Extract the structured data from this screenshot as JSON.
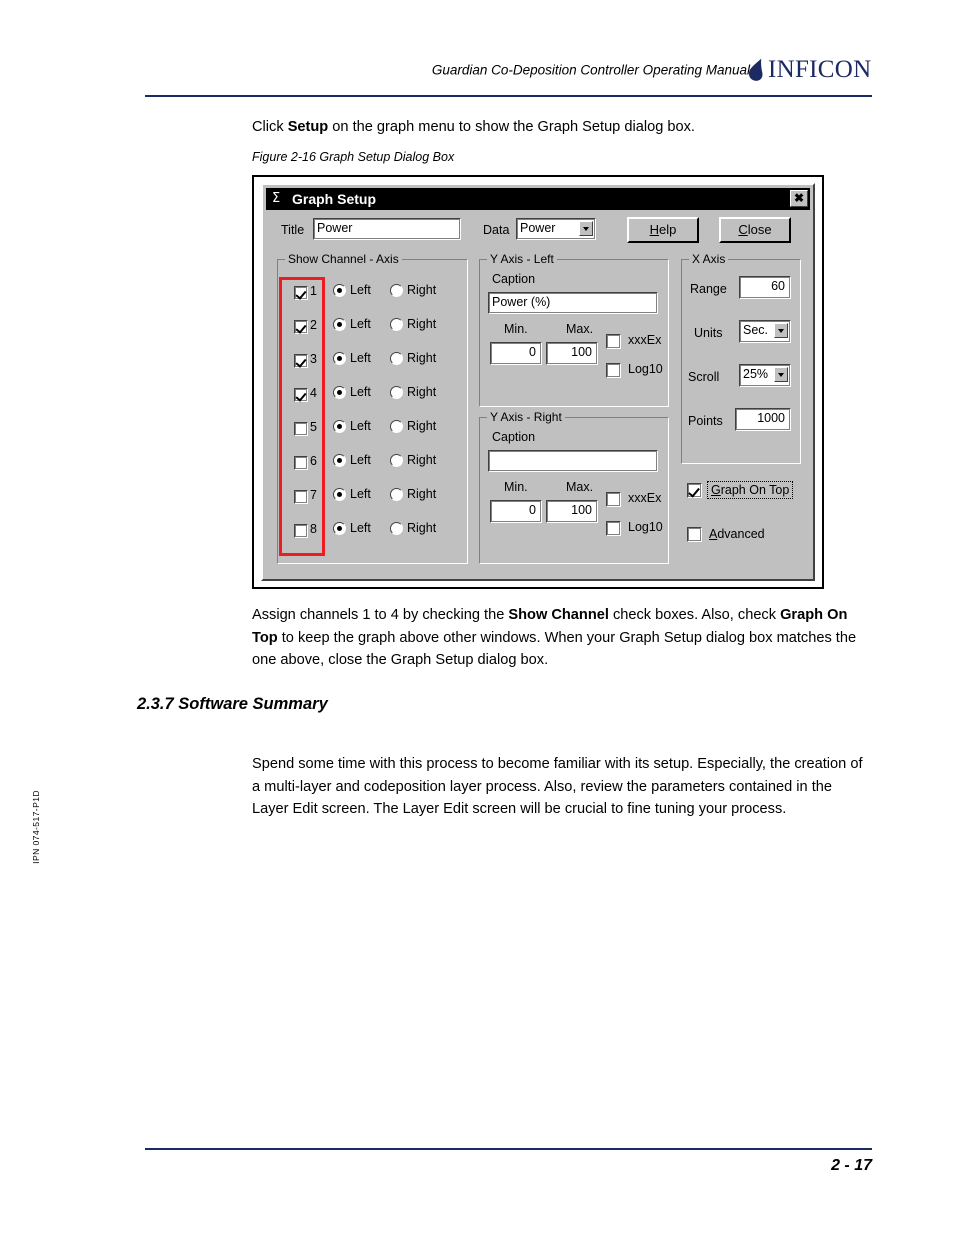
{
  "header": {
    "title": "Guardian Co-Deposition Controller Operating Manual",
    "logo_text": "INFICON",
    "logo_color": "#1b2a63",
    "rule_color": "#1b2a63"
  },
  "intro": {
    "before": "Click ",
    "bold": "Setup",
    "after": " on the graph menu to show the Graph Setup dialog box."
  },
  "figure_caption": "Figure 2-16  Graph Setup Dialog Box",
  "dialog": {
    "titlebar": {
      "icon": "Σ",
      "text": "Graph Setup",
      "close_glyph": "✖"
    },
    "title_label": "Title",
    "title_value": "Power",
    "data_label": "Data",
    "data_value": "Power",
    "help_button": {
      "mnemonic": "H",
      "rest": "elp"
    },
    "close_button": {
      "mnemonic": "C",
      "rest": "lose"
    },
    "channels_group": {
      "legend": "Show Channel - Axis",
      "left_label": "Left",
      "right_label": "Right",
      "rows": [
        {
          "num": "1",
          "checked": true,
          "axis": "left"
        },
        {
          "num": "2",
          "checked": true,
          "axis": "left"
        },
        {
          "num": "3",
          "checked": true,
          "axis": "left"
        },
        {
          "num": "4",
          "checked": true,
          "axis": "left"
        },
        {
          "num": "5",
          "checked": false,
          "axis": "left"
        },
        {
          "num": "6",
          "checked": false,
          "axis": "left"
        },
        {
          "num": "7",
          "checked": false,
          "axis": "left"
        },
        {
          "num": "8",
          "checked": false,
          "axis": "left"
        }
      ],
      "highlight_color": "#ee1b22"
    },
    "y_left": {
      "legend": "Y Axis - Left",
      "caption_label": "Caption",
      "caption_value": "Power (%)",
      "min_label": "Min.",
      "max_label": "Max.",
      "min_value": "0",
      "max_value": "100",
      "xxxex_label": "xxxEx",
      "xxxex_checked": false,
      "log10_label": "Log10",
      "log10_checked": false
    },
    "y_right": {
      "legend": "Y Axis - Right",
      "caption_label": "Caption",
      "caption_value": "",
      "min_label": "Min.",
      "max_label": "Max.",
      "min_value": "0",
      "max_value": "100",
      "xxxex_label": "xxxEx",
      "xxxex_checked": false,
      "log10_label": "Log10",
      "log10_checked": false
    },
    "x_axis": {
      "legend": "X Axis",
      "range_label": "Range",
      "range_value": "60",
      "units_label": "Units",
      "units_value": "Sec.",
      "scroll_label": "Scroll",
      "scroll_value": "25%",
      "points_label": "Points",
      "points_value": "1000"
    },
    "graph_on_top": {
      "mnemonic": "G",
      "rest": "raph On Top",
      "checked": true
    },
    "advanced": {
      "mnemonic": "A",
      "rest": "dvanced",
      "checked": false
    }
  },
  "post_text": {
    "p1": "Assign channels 1 to 4 by checking the ",
    "b1": "Show Channel",
    "p2": " check boxes. Also, check ",
    "b2": "Graph On Top",
    "p3": " to keep the graph above other windows. When your Graph Setup dialog box matches the one above, close the Graph Setup dialog box."
  },
  "section": {
    "heading": "2.3.7  Software Summary",
    "body": "Spend some time with this process to become familiar with its setup. Especially, the creation of a multi-layer and codeposition layer process. Also, review the parameters contained in the Layer Edit screen. The Layer Edit screen will be crucial to fine tuning your process."
  },
  "side_code": "IPN 074-517-P1D",
  "footer": {
    "page_number": "2 - 17"
  }
}
